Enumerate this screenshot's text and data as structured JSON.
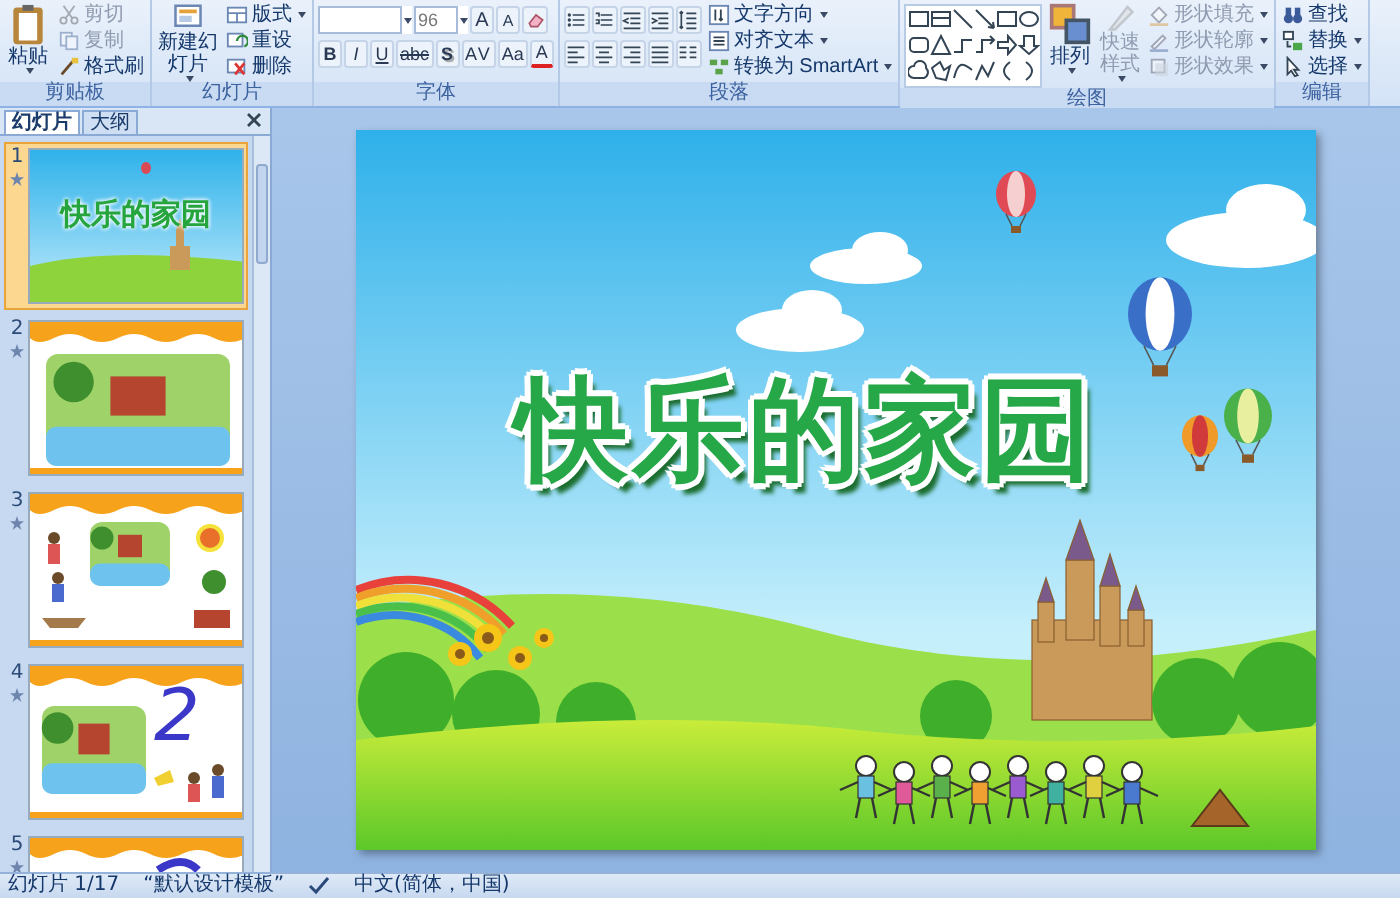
{
  "ribbon": {
    "groups": [
      {
        "label": "剪贴板",
        "sections": [
          {
            "kind": "large",
            "buttons": [
              {
                "label": "粘贴",
                "disabled": false,
                "dropdown": true
              }
            ]
          },
          {
            "kind": "stack",
            "buttons": [
              {
                "label": "剪切",
                "disabled": true
              },
              {
                "label": "复制",
                "disabled": true
              },
              {
                "label": "格式刷",
                "disabled": false
              }
            ]
          }
        ]
      },
      {
        "label": "幻灯片",
        "sections": [
          {
            "kind": "large",
            "buttons": [
              {
                "label": "新建幻灯片",
                "disabled": false,
                "dropdown": true
              }
            ]
          },
          {
            "kind": "stack",
            "buttons": [
              {
                "label": "版式",
                "disabled": false,
                "dropdown": true
              },
              {
                "label": "重设",
                "disabled": false
              },
              {
                "label": "删除",
                "disabled": false
              }
            ]
          }
        ]
      },
      {
        "label": "字体",
        "sections": [
          {
            "kind": "toolbars",
            "toolbars": [
              {
                "items": [
                  {
                    "kind": "field",
                    "dropdown": true
                  },
                  {
                    "kind": "field",
                    "value": "96",
                    "dropdown": true
                  },
                  {
                    "kind": "glyph",
                    "label": "A"
                  },
                  {
                    "kind": "glyph",
                    "label": "A"
                  },
                  {
                    "kind": "tool"
                  }
                ]
              },
              {
                "items": [
                  {
                    "kind": "glyph",
                    "label": "B"
                  },
                  {
                    "kind": "glyph",
                    "label": "I"
                  },
                  {
                    "kind": "glyph",
                    "label": "U"
                  },
                  {
                    "kind": "glyph",
                    "label": "abc"
                  },
                  {
                    "kind": "glyph",
                    "label": "S"
                  },
                  {
                    "kind": "glyph",
                    "label": "AV"
                  },
                  {
                    "kind": "glyph",
                    "label": "Aa"
                  },
                  {
                    "kind": "glyph",
                    "label": "A"
                  }
                ]
              }
            ]
          }
        ]
      },
      {
        "label": "段落",
        "sections": [
          {
            "kind": "toolbars",
            "toolbars": [
              {
                "items": [
                  {
                    "kind": "tool"
                  },
                  {
                    "kind": "tool"
                  },
                  {
                    "kind": "tool"
                  },
                  {
                    "kind": "tool"
                  },
                  {
                    "kind": "tool"
                  }
                ]
              },
              {
                "items": [
                  {
                    "kind": "tool"
                  },
                  {
                    "kind": "tool"
                  },
                  {
                    "kind": "tool"
                  },
                  {
                    "kind": "tool"
                  },
                  {
                    "kind": "tool"
                  }
                ]
              }
            ]
          },
          {
            "kind": "stack",
            "buttons": [
              {
                "label": "文字方向",
                "disabled": false,
                "dropdown": true
              },
              {
                "label": "对齐文本",
                "disabled": false,
                "dropdown": true
              },
              {
                "label": "转换为 SmartArt",
                "disabled": false,
                "dropdown": true
              }
            ]
          }
        ]
      },
      {
        "label": "绘图",
        "sections": [
          {
            "kind": "gallery"
          },
          {
            "kind": "large",
            "buttons": [
              {
                "label": "排列",
                "disabled": false,
                "dropdown": true
              },
              {
                "label": "快速样式",
                "disabled": true,
                "dropdown": true
              }
            ]
          },
          {
            "kind": "stack",
            "buttons": [
              {
                "label": "形状填充",
                "disabled": true,
                "dropdown": true
              },
              {
                "label": "形状轮廓",
                "disabled": true,
                "dropdown": true
              },
              {
                "label": "形状效果",
                "disabled": true,
                "dropdown": true
              }
            ]
          }
        ]
      },
      {
        "label": "编辑",
        "sections": [
          {
            "kind": "stack",
            "buttons": [
              {
                "label": "查找",
                "disabled": false
              },
              {
                "label": "替换",
                "disabled": false,
                "dropdown": true
              },
              {
                "label": "选择",
                "disabled": false,
                "dropdown": true
              }
            ]
          }
        ]
      }
    ]
  },
  "pane": {
    "tabs": [
      {
        "label": "幻灯片",
        "selected": true
      },
      {
        "label": "大纲",
        "selected": false
      }
    ],
    "slides": [
      {
        "number": "1",
        "selected": true,
        "kind": "title",
        "title": "快乐的家园"
      },
      {
        "number": "2",
        "selected": false,
        "kind": "scene"
      },
      {
        "number": "3",
        "selected": false,
        "kind": "items"
      },
      {
        "number": "4",
        "selected": false,
        "kind": "digit",
        "digit": "2"
      },
      {
        "number": "5",
        "selected": false,
        "kind": "partial"
      }
    ]
  },
  "slide": {
    "title": "快乐的家园"
  },
  "status_bar": {
    "slide_number": "幻灯片 1/17",
    "theme": "“默认设计模板”",
    "language": "中文(简体，中国)"
  }
}
